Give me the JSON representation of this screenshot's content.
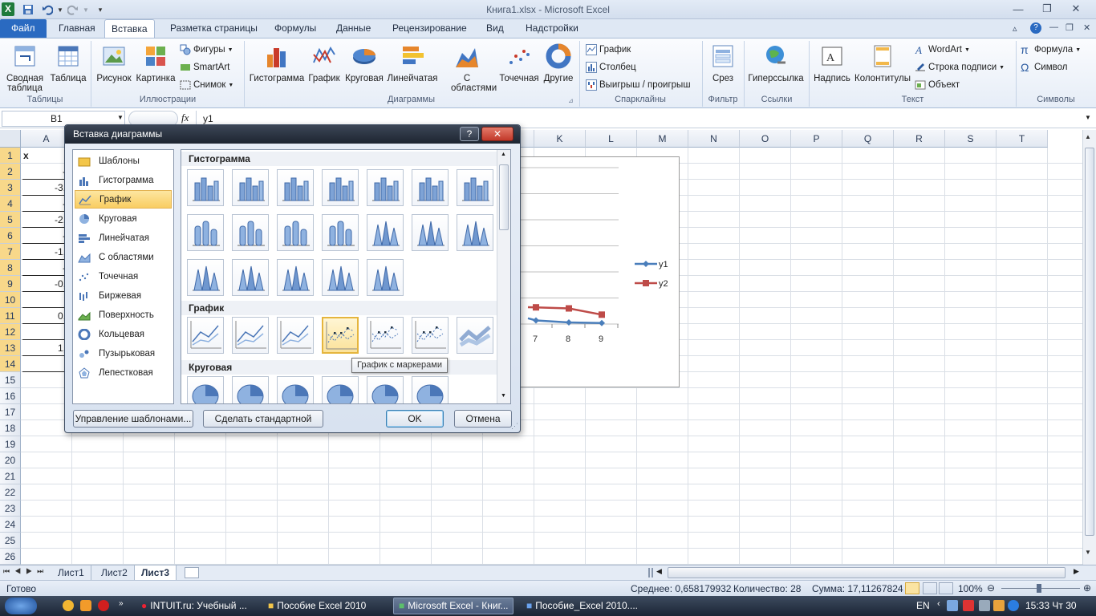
{
  "window": {
    "title": "Книга1.xlsx  -  Microsoft Excel"
  },
  "ribbon": {
    "tabs": [
      "Файл",
      "Главная",
      "Вставка",
      "Разметка страницы",
      "Формулы",
      "Данные",
      "Рецензирование",
      "Вид",
      "Надстройки"
    ],
    "active_tab": "Вставка",
    "groups": {
      "tables": "Таблицы",
      "illustrations": "Иллюстрации",
      "charts": "Диаграммы",
      "sparklines": "Спарклайны",
      "filter": "Фильтр",
      "links": "Ссылки",
      "text": "Текст",
      "symbols": "Символы"
    },
    "buttons": {
      "pivot": "Сводная таблица",
      "table": "Таблица",
      "picture": "Рисунок",
      "clipart": "Картинка",
      "shapes": "Фигуры",
      "smartart": "SmartArt",
      "screenshot": "Снимок",
      "histogram": "Гистограмма",
      "line": "График",
      "pie": "Круговая",
      "bar": "Линейчатая",
      "area": "С областями",
      "scatter": "Точечная",
      "other": "Другие",
      "spark_line": "График",
      "spark_column": "Столбец",
      "spark_winloss": "Выигрыш / проигрыш",
      "slicer": "Срез",
      "hyperlink": "Гиперссылка",
      "textbox": "Надпись",
      "headers": "Колонтитулы",
      "wordart": "WordArt",
      "sigline": "Строка подписи",
      "object": "Объект",
      "formula": "Формула",
      "symbol": "Символ"
    }
  },
  "formula_bar": {
    "name_box": "B1",
    "fx": "fx",
    "content": "y1"
  },
  "sheet": {
    "columns": [
      "A",
      "B",
      "C",
      "D",
      "E",
      "F",
      "G",
      "H",
      "I",
      "J",
      "K",
      "L",
      "M",
      "N",
      "O",
      "P",
      "Q",
      "R",
      "S",
      "T"
    ],
    "rows": [
      "1",
      "2",
      "3",
      "4",
      "5",
      "6",
      "7",
      "8",
      "9",
      "10",
      "11",
      "12",
      "13",
      "14",
      "15",
      "16",
      "17",
      "18",
      "19",
      "20",
      "21",
      "22",
      "23",
      "24",
      "25",
      "26"
    ],
    "visible_cells_a": [
      "x",
      "-",
      "-3,",
      "-",
      "-2,",
      "-",
      "-1,",
      "-",
      "-0,",
      "",
      "0,",
      "",
      "1,",
      ""
    ]
  },
  "chart_data": {
    "type": "line",
    "categories": [
      "7",
      "8",
      "9"
    ],
    "series": [
      {
        "name": "y1",
        "values": [
          0.35,
          0.15,
          0.1
        ]
      },
      {
        "name": "y2",
        "values": [
          1.6,
          1.5,
          0.9
        ]
      }
    ],
    "legend": "right",
    "grid": true,
    "colors": {
      "y1": "#4a7ebb",
      "y2": "#be4b48"
    }
  },
  "dialog": {
    "title": "Вставка диаграммы",
    "help": "?",
    "categories": [
      "Шаблоны",
      "Гистограмма",
      "График",
      "Круговая",
      "Линейчатая",
      "С областями",
      "Точечная",
      "Биржевая",
      "Поверхность",
      "Кольцевая",
      "Пузырьковая",
      "Лепестковая"
    ],
    "selected_category": "График",
    "sections": {
      "histogram": "Гистограмма",
      "line": "График",
      "pie": "Круговая"
    },
    "tooltip": "График с маркерами",
    "buttons": {
      "manage": "Управление шаблонами...",
      "set_default": "Сделать стандартной",
      "ok": "OK",
      "cancel": "Отмена"
    }
  },
  "sheet_tabs": [
    "Лист1",
    "Лист2",
    "Лист3"
  ],
  "active_sheet": "Лист3",
  "status": {
    "ready": "Готово",
    "average": "Среднее: 0,658179932",
    "count": "Количество: 28",
    "sum": "Сумма: 17,11267824",
    "zoom": "100%"
  },
  "taskbar": {
    "items": [
      "INTUIT.ru: Учебный ...",
      "Пособие Excel 2010",
      "Microsoft Excel - Книг...",
      "Пособие_Excel 2010...."
    ],
    "lang": "EN",
    "clock": "15:33 Чт 30"
  }
}
